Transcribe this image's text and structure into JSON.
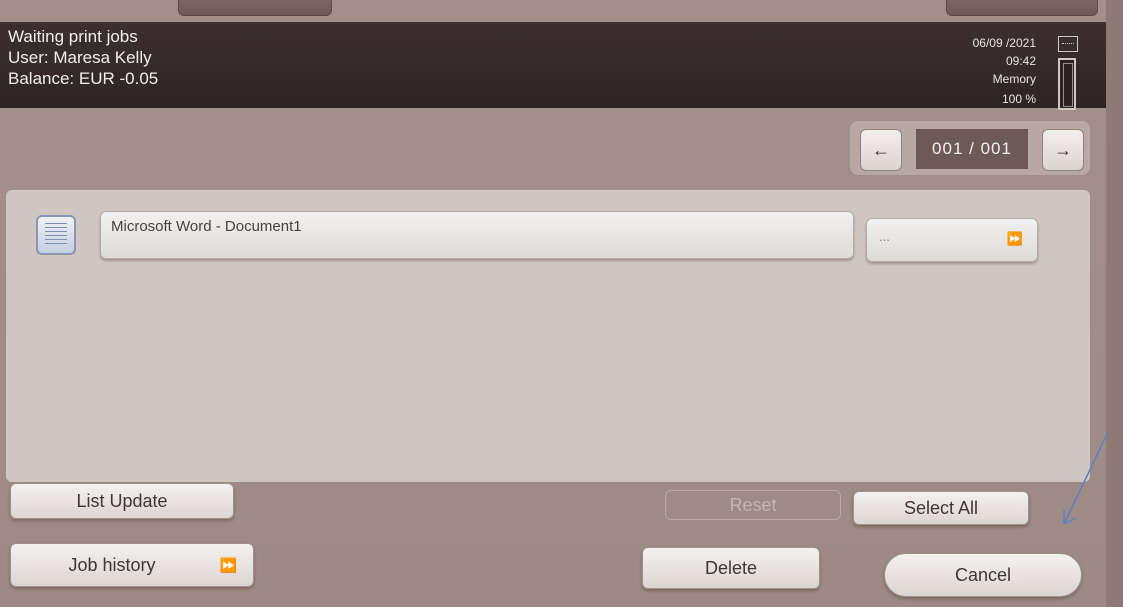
{
  "header": {
    "title": "Waiting print jobs",
    "user": "User: Maresa Kelly",
    "balance": "Balance: EUR -0.05",
    "date": "06/09 /2021",
    "time": "09:42",
    "memory_label": "Memory",
    "memory_percent": "100 %"
  },
  "pager": {
    "prev_icon": "left-arrow-icon",
    "next_icon": "right-arrow-icon",
    "prev_glyph": "←",
    "next_glyph": "→",
    "display": "001 /  001"
  },
  "jobs": [
    {
      "name": "Microsoft Word - Document1",
      "more": "...",
      "more_glyph": "⏩"
    }
  ],
  "buttons": {
    "list_update": "List Update",
    "reset": "Reset",
    "select_all": "Select All",
    "job_history": "Job history",
    "job_history_glyph": "⏩",
    "delete": "Delete",
    "cancel": "Cancel"
  },
  "colors": {
    "header_bg": "#2e2424",
    "panel_bg": "#cfc6c2",
    "screen_bg": "#9d8a84",
    "annotation_arrow": "#5b7fcb"
  }
}
